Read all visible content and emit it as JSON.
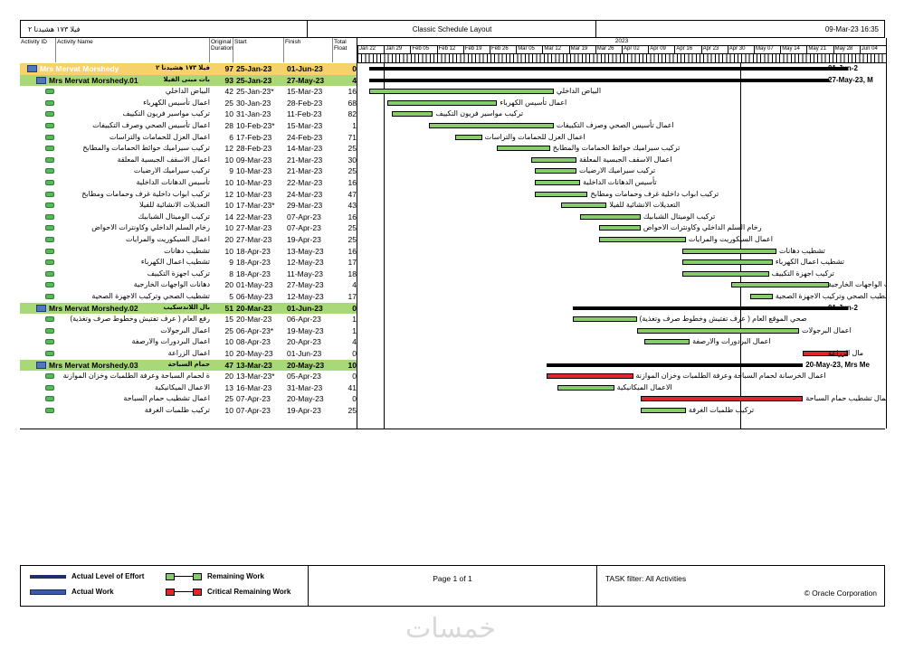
{
  "header": {
    "project_label": "فيلا ١٧٣ هشيدنا ٢",
    "title": "Classic Schedule Layout",
    "date": "09-Mar-23 16:35"
  },
  "columns": {
    "activity_id": "Activity ID",
    "activity_name": "Activity Name",
    "original_duration": "Original Duration",
    "start": "Start",
    "finish": "Finish",
    "total_float": "Total Float"
  },
  "timeline": {
    "year": "2023",
    "weeks": [
      "Jan 22",
      "Jan 29",
      "Feb 05",
      "Feb 12",
      "Feb 19",
      "Feb 26",
      "Mar 05",
      "Mar 12",
      "Mar 19",
      "Mar 26",
      "Apr 02",
      "Apr 09",
      "Apr 16",
      "Apr 23",
      "Apr 30",
      "May 07",
      "May 14",
      "May 21",
      "May 28",
      "Jun 04"
    ]
  },
  "rows": [
    {
      "level": 0,
      "name": "Mrs Mervat Morshedy",
      "name_ar": "فيلا ١٧٣ هشيدنا ٢",
      "dur": "97",
      "start": "25-Jan-23",
      "finish": "01-Jun-23",
      "float": "0"
    },
    {
      "level": 1,
      "name": "Mrs Mervat Morshedy.01",
      "name_ar": "بات مبنى الفيلا",
      "dur": "93",
      "start": "25-Jan-23",
      "finish": "27-May-23",
      "float": "4"
    },
    {
      "level": 2,
      "name": "البياض الداخلي",
      "dur": "42",
      "start": "25-Jan-23*",
      "finish": "15-Mar-23",
      "float": "16"
    },
    {
      "level": 2,
      "name": "اعمال تأسيس الكهرباء",
      "dur": "25",
      "start": "30-Jan-23",
      "finish": "28-Feb-23",
      "float": "68"
    },
    {
      "level": 2,
      "name": "تركيب مواسير فريون التكييف",
      "dur": "10",
      "start": "31-Jan-23",
      "finish": "11-Feb-23",
      "float": "82"
    },
    {
      "level": 2,
      "name": "اعمال تأسيس الصحي وصرف التكييفات",
      "dur": "28",
      "start": "10-Feb-23*",
      "finish": "15-Mar-23",
      "float": "1"
    },
    {
      "level": 2,
      "name": "اعمال العزل للحمامات والتراسات",
      "dur": "6",
      "start": "17-Feb-23",
      "finish": "24-Feb-23",
      "float": "71"
    },
    {
      "level": 2,
      "name": "تركيب سيراميك حوائط الحمامات والمطابخ",
      "dur": "12",
      "start": "28-Feb-23",
      "finish": "14-Mar-23",
      "float": "25"
    },
    {
      "level": 2,
      "name": "اعمال الاسقف الجبسية المعلقة",
      "dur": "10",
      "start": "09-Mar-23",
      "finish": "21-Mar-23",
      "float": "30"
    },
    {
      "level": 2,
      "name": "تركيب سيراميك الارضيات",
      "dur": "9",
      "start": "10-Mar-23",
      "finish": "21-Mar-23",
      "float": "25"
    },
    {
      "level": 2,
      "name": "تأسيس الدهانات الداخلية",
      "dur": "10",
      "start": "10-Mar-23",
      "finish": "22-Mar-23",
      "float": "16"
    },
    {
      "level": 2,
      "name": "تركيب ابواب داخلية غرف وحمامات ومطابخ",
      "dur": "12",
      "start": "10-Mar-23",
      "finish": "24-Mar-23",
      "float": "47"
    },
    {
      "level": 2,
      "name": "التعديلات الانشائية للفيلا",
      "dur": "10",
      "start": "17-Mar-23*",
      "finish": "29-Mar-23",
      "float": "43"
    },
    {
      "level": 2,
      "name": "تركيب الوميتال الشبابيك",
      "dur": "14",
      "start": "22-Mar-23",
      "finish": "07-Apr-23",
      "float": "16"
    },
    {
      "level": 2,
      "name": "رخام السلم الداخلي وكاونترات الاحواض",
      "dur": "10",
      "start": "27-Mar-23",
      "finish": "07-Apr-23",
      "float": "25"
    },
    {
      "level": 2,
      "name": "اعمال السيكوريت والمرايات",
      "dur": "20",
      "start": "27-Mar-23",
      "finish": "19-Apr-23",
      "float": "25"
    },
    {
      "level": 2,
      "name": "تشطيب دهانات",
      "dur": "10",
      "start": "18-Apr-23",
      "finish": "13-May-23",
      "float": "16"
    },
    {
      "level": 2,
      "name": "تشطيب اعمال الكهرباء",
      "dur": "9",
      "start": "18-Apr-23",
      "finish": "12-May-23",
      "float": "17"
    },
    {
      "level": 2,
      "name": "تركيب اجهزة التكييف",
      "dur": "8",
      "start": "18-Apr-23",
      "finish": "11-May-23",
      "float": "18"
    },
    {
      "level": 2,
      "name": "دهانات الواجهات الخارجية",
      "dur": "20",
      "start": "01-May-23",
      "finish": "27-May-23",
      "float": "4"
    },
    {
      "level": 2,
      "name": "تشطيب الصحي وتركيب الاجهزة الصحية",
      "dur": "5",
      "start": "06-May-23",
      "finish": "12-May-23",
      "float": "17"
    },
    {
      "level": 1,
      "name": "Mrs Mervat Morshedy.02",
      "name_ar": "بال اللاندسكيب",
      "dur": "51",
      "start": "20-Mar-23",
      "finish": "01-Jun-23",
      "float": "0"
    },
    {
      "level": 2,
      "name": "رفع العام ( عرف تفتيش وخطوط صرف وتغذية)",
      "dur": "15",
      "start": "20-Mar-23",
      "finish": "06-Apr-23",
      "float": "1"
    },
    {
      "level": 2,
      "name": "اعمال البرجولات",
      "dur": "25",
      "start": "06-Apr-23*",
      "finish": "19-May-23",
      "float": "1"
    },
    {
      "level": 2,
      "name": "اعمال البردورات والارصفة",
      "dur": "10",
      "start": "08-Apr-23",
      "finish": "20-Apr-23",
      "float": "4"
    },
    {
      "level": 2,
      "name": "اعمال الزراعة",
      "dur": "10",
      "start": "20-May-23",
      "finish": "01-Jun-23",
      "float": "0"
    },
    {
      "level": 1,
      "name": "Mrs Mervat Morshedy.03",
      "name_ar": "حمام السباحة",
      "dur": "47",
      "start": "13-Mar-23",
      "finish": "20-May-23",
      "float": "10"
    },
    {
      "level": 2,
      "name": "ة لحمام السباحة وعرفة الطلمبات وخزان الموازنة",
      "dur": "20",
      "start": "13-Mar-23*",
      "finish": "05-Apr-23",
      "float": "0"
    },
    {
      "level": 2,
      "name": "الاعمال الميكانيكية",
      "dur": "13",
      "start": "16-Mar-23",
      "finish": "31-Mar-23",
      "float": "41"
    },
    {
      "level": 2,
      "name": "اعمال تشطيب حمام السباحة",
      "dur": "25",
      "start": "07-Apr-23",
      "finish": "20-May-23",
      "float": "0"
    },
    {
      "level": 2,
      "name": "تركيب طلمبات الغرفة",
      "dur": "10",
      "start": "07-Apr-23",
      "finish": "19-Apr-23",
      "float": "25"
    }
  ],
  "bar_labels": {
    "r0": "01-Jun-2",
    "r1": "27-May-23, M",
    "r21": "01-Jun-2",
    "r26": "20-May-23, Mrs Me",
    "r25": "مال الزراعة",
    "r28": "الاعمال الميكانيكية",
    "r27": "اعمال الخرسانة لحمام السباحة وعرفة الطلمبات وخزان الموازنة",
    "r29": "اعمال تشطيب حمام السباحة",
    "r22": "صحي الموقع العام ( عرف تفتيش وخطوط صرف وتغذية)",
    "r23": "اعمال البرجولات",
    "r24": "اعمال البردورات والارصفة",
    "r30": "تركيب طلمبات الغرفة"
  },
  "footer": {
    "legend": {
      "actual_level_of_effort": "Actual Level of Effort",
      "actual_work": "Actual Work",
      "remaining_work": "Remaining Work",
      "critical_remaining_work": "Critical Remaining Work"
    },
    "page": "Page 1 of 1",
    "filter": "TASK filter: All Activities",
    "copyright": "© Oracle Corporation"
  },
  "watermark": "خمسات",
  "colors": {
    "wbs_level0": "#f7d26a",
    "wbs_level1": "#a9d878",
    "remaining_bar": "#86cc6a",
    "critical_bar": "#e0262a",
    "actual_loe": "#1f2d6b",
    "actual_work": "#3a5ca8"
  }
}
